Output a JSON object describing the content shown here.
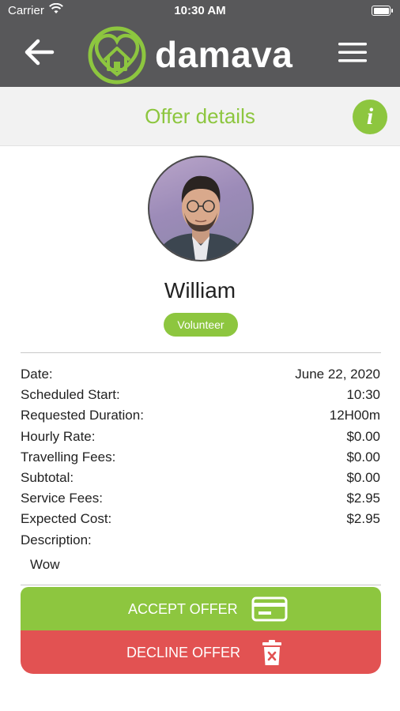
{
  "status_bar": {
    "carrier": "Carrier",
    "time": "10:30 AM"
  },
  "nav": {
    "brand": "damava"
  },
  "page": {
    "title": "Offer details"
  },
  "profile": {
    "name": "William",
    "role": "Volunteer"
  },
  "details": [
    {
      "label": "Date:",
      "value": "June 22, 2020"
    },
    {
      "label": "Scheduled Start:",
      "value": "10:30"
    },
    {
      "label": "Requested Duration:",
      "value": "12H00m"
    },
    {
      "label": "Hourly Rate:",
      "value": "$0.00"
    },
    {
      "label": "Travelling Fees:",
      "value": "$0.00"
    },
    {
      "label": "Subtotal:",
      "value": "$0.00"
    },
    {
      "label": "Service Fees:",
      "value": "$2.95"
    },
    {
      "label": "Expected Cost:",
      "value": "$2.95"
    },
    {
      "label": "Description:",
      "value": ""
    }
  ],
  "description": "Wow",
  "actions": {
    "accept_label": "ACCEPT OFFER",
    "decline_label": "DECLINE OFFER"
  },
  "icons": {
    "back": "arrow-left-icon",
    "menu": "hamburger-menu-icon",
    "info": "info-icon",
    "logo": "heart-home-logo",
    "accept": "credit-card-icon",
    "decline": "trash-icon"
  },
  "colors": {
    "brand_green": "#8dc63f",
    "header_gray": "#58585a",
    "decline_red": "#e25252",
    "title_bg": "#f2f2f2"
  }
}
